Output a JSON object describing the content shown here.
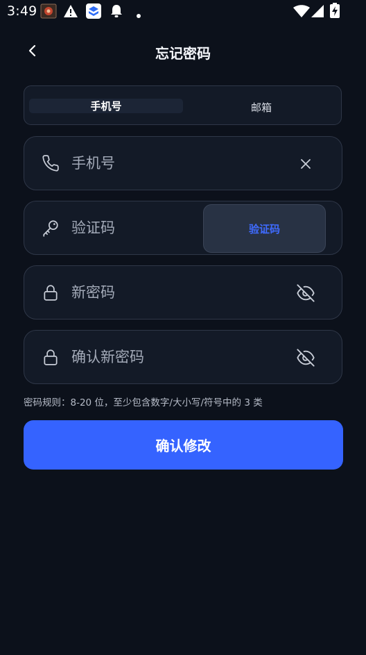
{
  "status_bar": {
    "time": "3:49",
    "icons": [
      "app-notification-icon",
      "warning-icon",
      "app-store-icon",
      "bell-icon",
      "dot-icon",
      "wifi-icon",
      "signal-icon",
      "battery-charging-icon"
    ]
  },
  "header": {
    "back_icon": "chevron-left-icon",
    "title": "忘记密码"
  },
  "tabs": [
    {
      "label": "手机号",
      "active": true
    },
    {
      "label": "邮箱",
      "active": false
    }
  ],
  "form": {
    "phone": {
      "placeholder": "手机号",
      "value": "",
      "icon": "phone-icon",
      "action_icon": "clear-icon"
    },
    "code": {
      "placeholder": "验证码",
      "value": "",
      "icon": "key-icon",
      "button_label": "验证码"
    },
    "new_password": {
      "placeholder": "新密码",
      "value": "",
      "icon": "lock-icon",
      "action_icon": "eye-off-icon"
    },
    "confirm_password": {
      "placeholder": "确认新密码",
      "value": "",
      "icon": "lock-icon",
      "action_icon": "eye-off-icon"
    }
  },
  "rule_hint": "密码规则：8-20 位，至少包含数字/大小写/符号中的 3 类",
  "submit_label": "确认修改",
  "colors": {
    "background": "#0c111b",
    "card": "#131a27",
    "border": "#2f3748",
    "accent": "#3563ff",
    "code_text": "#3f6bff"
  }
}
